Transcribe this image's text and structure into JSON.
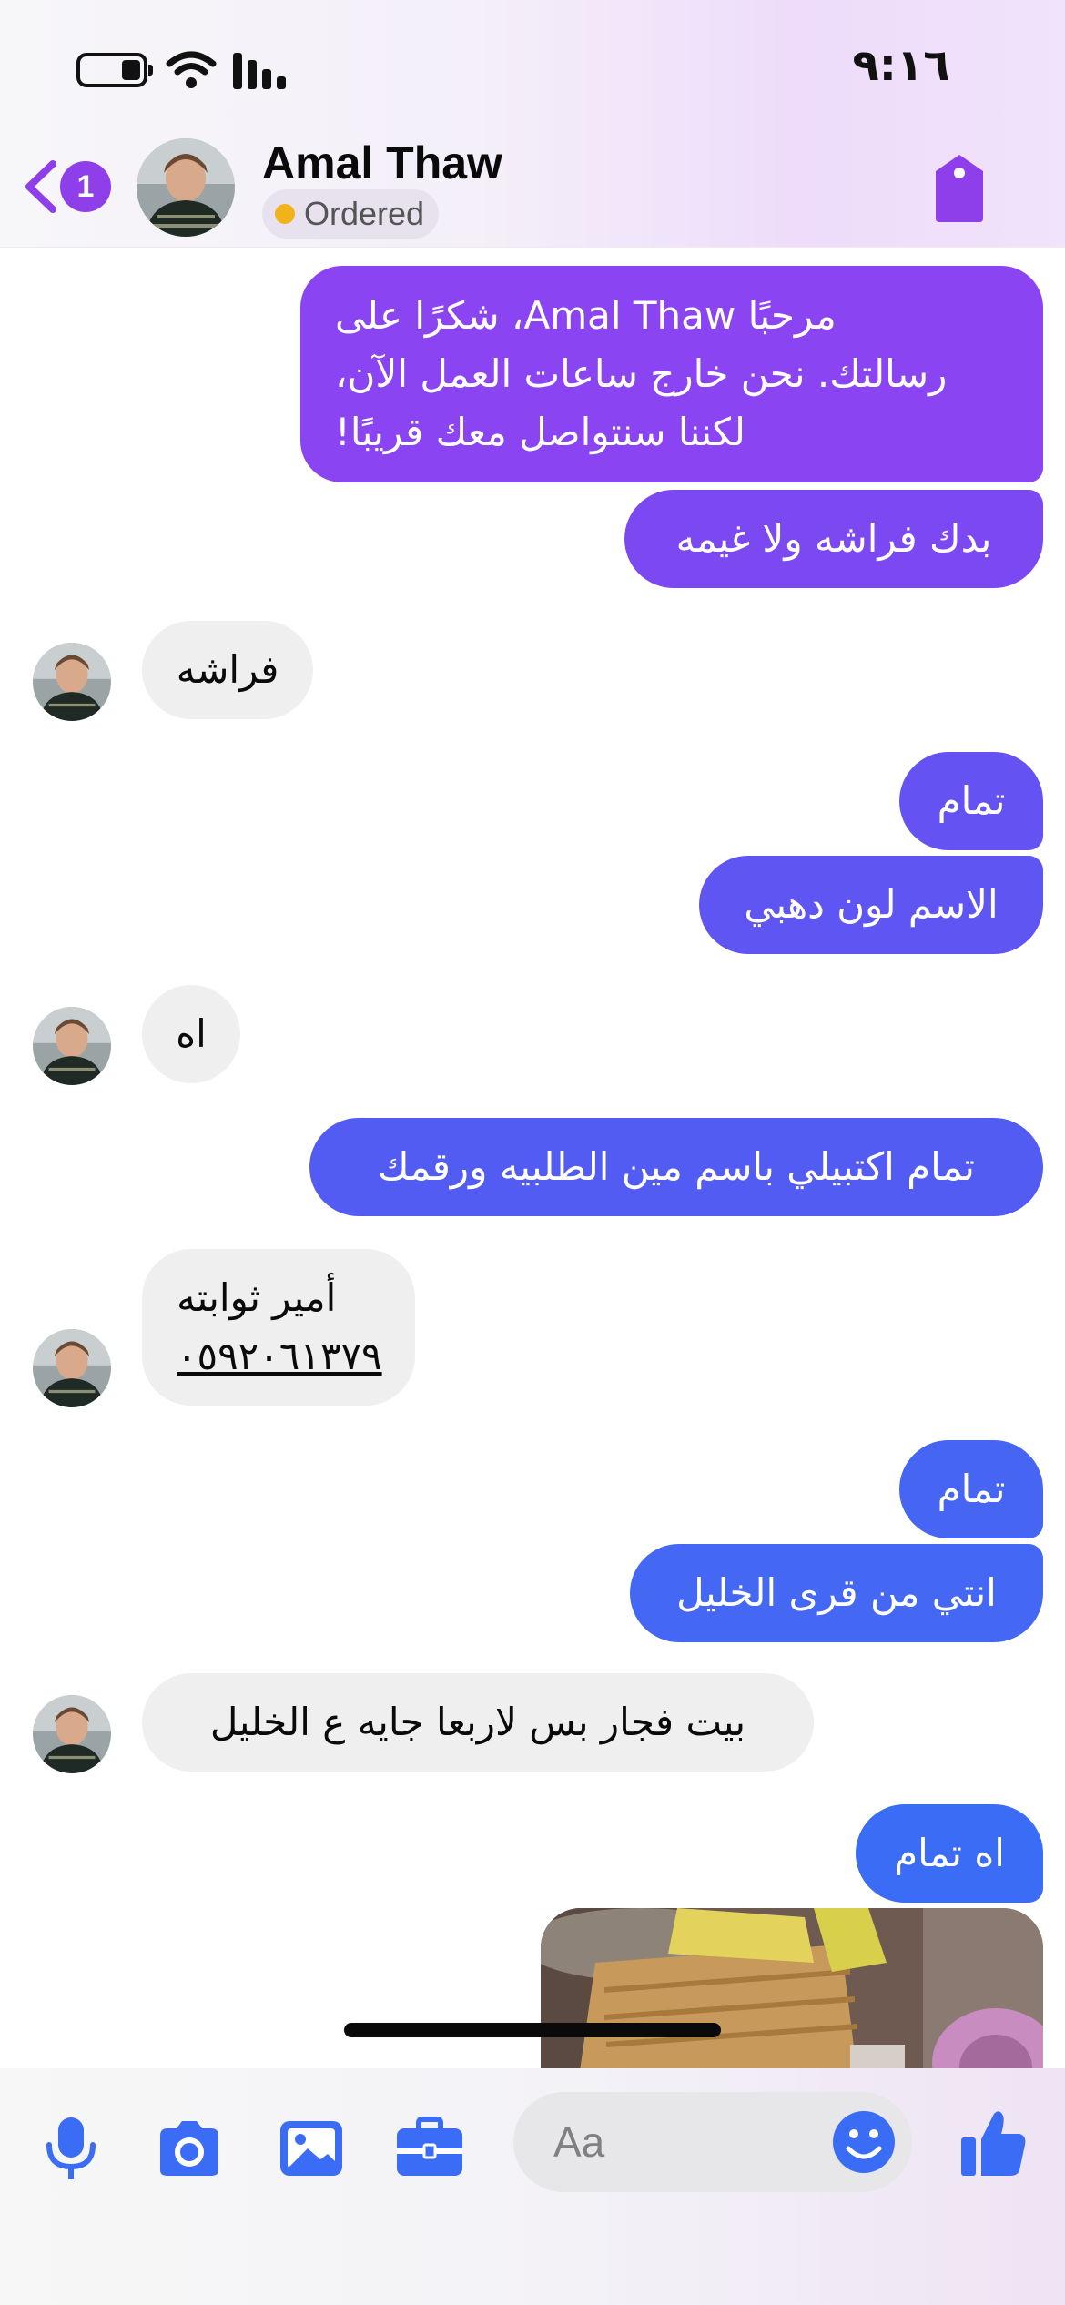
{
  "status_bar": {
    "time": "٩:١٦"
  },
  "header": {
    "unread_count": "1",
    "contact_name": "Amal Thaw",
    "status_label": "Ordered"
  },
  "messages": [
    {
      "side": "out",
      "lines": [
        "مرحبًا Amal Thaw، شكرًا على",
        "رسالتك. نحن خارج ساعات العمل الآن،",
        "لكننا سنتواصل معك قريبًا!"
      ]
    },
    {
      "side": "out",
      "text": "بدك فراشه ولا غيمه"
    },
    {
      "side": "in",
      "text": "فراشه"
    },
    {
      "side": "out",
      "text": "تمام"
    },
    {
      "side": "out",
      "text": "الاسم لون دهبي"
    },
    {
      "side": "in",
      "text": "اه"
    },
    {
      "side": "out",
      "text": "تمام اكتبيلي باسم مين الطلبيه ورقمك"
    },
    {
      "side": "in",
      "lines": [
        "أمير ثوابته",
        "٠٥٩٢٠٦١٣٧٩"
      ]
    },
    {
      "side": "out",
      "text": "تمام"
    },
    {
      "side": "out",
      "text": "انتي من قرى الخليل"
    },
    {
      "side": "in",
      "text": "بيت فجار بس لاربعا جايه ع الخليل"
    },
    {
      "side": "out",
      "text": "اه تمام"
    }
  ],
  "composer": {
    "placeholder": "Aa"
  },
  "colors": {
    "accent_purple": "#8f3fea",
    "accent_blue": "#3b6cf5",
    "incoming_bubble": "#efefef",
    "status_dot": "#f2b21c"
  },
  "icons": [
    "battery-icon",
    "wifi-icon",
    "signal-icon",
    "back-chevron-icon",
    "tag-icon",
    "microphone-icon",
    "camera-icon",
    "image-icon",
    "briefcase-icon",
    "emoji-icon",
    "thumbs-up-icon"
  ]
}
